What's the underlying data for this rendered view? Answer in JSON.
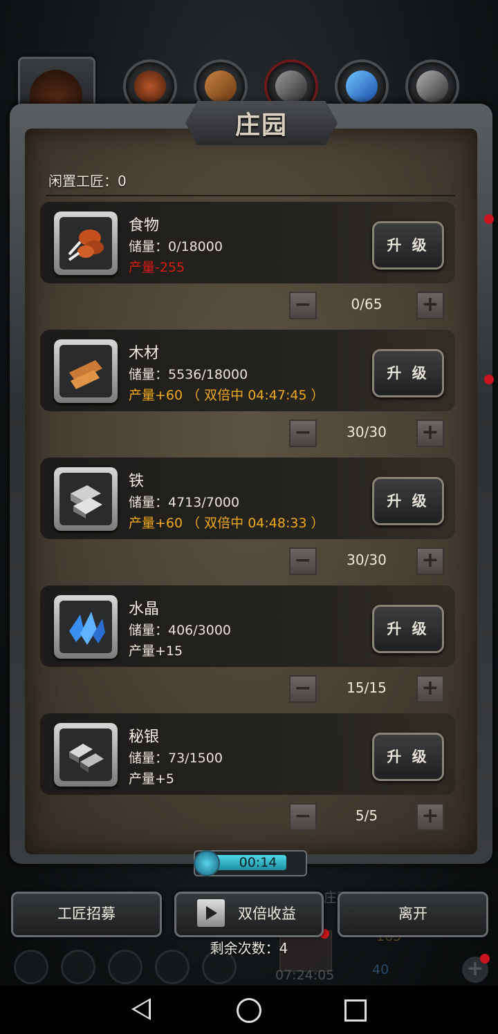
{
  "panel": {
    "title": "庄园",
    "idle_workers": "闲置工匠：0"
  },
  "resources": [
    {
      "name": "食物",
      "stock": "储量：0/18000",
      "production": "产量-255",
      "production_color": "#d61b12",
      "upgrade": "升 级",
      "workers": "0/65",
      "icon": "meat-icon"
    },
    {
      "name": "木材",
      "stock": "储量：5536/18000",
      "production": "产量+60 （ 双倍中 04:47:45 ）",
      "production_color": "#f0a91a",
      "upgrade": "升 级",
      "workers": "30/30",
      "icon": "wood-planks-icon"
    },
    {
      "name": "铁",
      "stock": "储量：4713/7000",
      "production": "产量+60 （ 双倍中 04:48:33 ）",
      "production_color": "#f0a91a",
      "upgrade": "升 级",
      "workers": "30/30",
      "icon": "iron-ingot-icon"
    },
    {
      "name": "水晶",
      "stock": "储量：406/3000",
      "production": "产量+15",
      "production_color": "#ede8dd",
      "upgrade": "升 级",
      "workers": "15/15",
      "icon": "crystal-icon"
    },
    {
      "name": "秘银",
      "stock": "储量：73/1500",
      "production": "产量+5",
      "production_color": "#ede8dd",
      "upgrade": "升 级",
      "workers": "5/5",
      "icon": "mithril-ingot-icon"
    }
  ],
  "stepper": {
    "minus": "−",
    "plus": "+"
  },
  "timer": "00:14",
  "buttons": {
    "recruit": "工匠招募",
    "double": "双倍收益",
    "leave": "离开"
  },
  "remaining": "剩余次数：4",
  "background_hud": {
    "label": "庄园",
    "gold": "165",
    "gems": "40",
    "clock": "07:24:05",
    "add": "+"
  }
}
